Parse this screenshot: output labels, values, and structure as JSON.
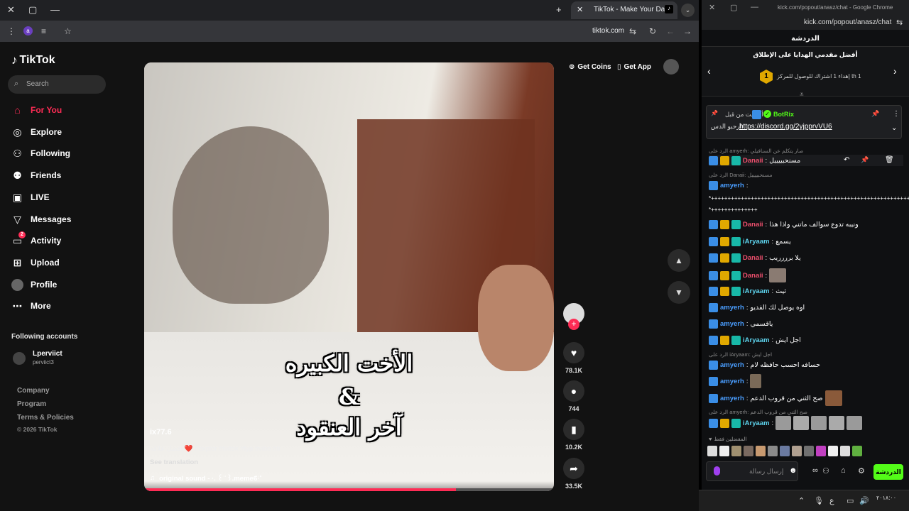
{
  "left_window": {
    "tab_title": "TikTok - Make Your Day",
    "url": "tiktok.com",
    "profile_badge": "a"
  },
  "tiktok": {
    "logo": "TikTok",
    "search_placeholder": "Search",
    "nav": [
      {
        "label": "For You",
        "icon": "home-icon"
      },
      {
        "label": "Explore",
        "icon": "compass-icon"
      },
      {
        "label": "Following",
        "icon": "user-follow-icon"
      },
      {
        "label": "Friends",
        "icon": "friends-icon"
      },
      {
        "label": "LIVE",
        "icon": "live-icon"
      },
      {
        "label": "Messages",
        "icon": "message-icon"
      },
      {
        "label": "Activity",
        "icon": "activity-icon",
        "badge": "2"
      },
      {
        "label": "Upload",
        "icon": "upload-icon"
      },
      {
        "label": "Profile",
        "icon": "profile-icon"
      },
      {
        "label": "More",
        "icon": "more-icon"
      }
    ],
    "following_heading": "Following accounts",
    "following_account": {
      "name": "Lperviict",
      "handle": "perviict3"
    },
    "footer_links": [
      "Company",
      "Program",
      "Terms & Policies"
    ],
    "copyright": "© 2026 TikTok",
    "top_actions": {
      "coins": "Get Coins",
      "app": "Get App"
    },
    "video": {
      "caption_line1": "الأخت الكبيره",
      "caption_line2": "&",
      "caption_line3": "آخر العنقود",
      "author": "ix77.6",
      "description": "افضل علاقه ❤️ #explor #tiktok #fyp #vibe #ti",
      "see_translation": "See translation",
      "sound": "original sound - ·. ꒰ ̈ ꒱.memeϐ̈·˚",
      "progress": 0.76
    },
    "rail": {
      "likes": "78.1K",
      "comments": "744",
      "saves": "10.2K",
      "shares": "33.5K"
    }
  },
  "right_window": {
    "title": "kick.com/popout/anasz/chat - Google Chrome",
    "url": "kick.com/popout/anasz/chat",
    "header": "الدردشة",
    "top_gifters_title": "أفضل مقدمي الهدايا على الإطلاق",
    "top_gifter_rank": "1",
    "top_gifter_text": "إهداء 1 اشتراك للوصول للمركز th 1",
    "pinned": {
      "pinned_by": "أرسلت من قبل",
      "bot": "BotRix",
      "message_prefix": "ارحبو الدس",
      "link": "https://discord.gg/2yjpprvVU6"
    },
    "messages": [
      {
        "reply": "الرد على amyerh: صار يتكلم عن السنافيلي",
        "user": "Danaii",
        "text": "مسنحبييييل",
        "color": "#f0506e"
      },
      {
        "reply": "الرد على Danaii: مسنحبييييل",
        "user": "amyerh",
        "text": "",
        "color": "#4a9eff"
      },
      {
        "user": "",
        "text": "*++++++++++++++++++++++++++++++++++++++++++++++++++++++++++++",
        "color": "#fff"
      },
      {
        "user": "",
        "text": "*++++++++++++++",
        "color": "#fff"
      },
      {
        "user": "Danaii",
        "text": "ونيبه تدوع سوالف ماتني واذا هذا",
        "color": "#f0506e"
      },
      {
        "user": "iAryaam",
        "text": "يسمع",
        "color": "#5fd6f0"
      },
      {
        "user": "Danaii",
        "text": "يلا برررريب",
        "color": "#f0506e"
      },
      {
        "user": "Danaii",
        "text": "",
        "color": "#f0506e"
      },
      {
        "user": "iAryaam",
        "text": "ثيث",
        "color": "#5fd6f0"
      },
      {
        "user": "amyerh",
        "text": "اوه يوصل لك الفديو",
        "color": "#4a9eff"
      },
      {
        "user": "amyerh",
        "text": "ياقسمي",
        "color": "#4a9eff"
      },
      {
        "user": "iAryaam",
        "text": "اجل ايش",
        "color": "#5fd6f0"
      },
      {
        "reply": "الرد على iAryaam: اجل ايش",
        "user": "amyerh",
        "text": "حسافه احسب حافظه لام",
        "color": "#4a9eff"
      },
      {
        "user": "amyerh",
        "text": "",
        "color": "#4a9eff"
      },
      {
        "user": "amyerh",
        "text": "صح الثني من قروب الدعم",
        "color": "#4a9eff"
      },
      {
        "reply": "الرد على amyerh: صح الثني من قروب الدعم",
        "user": "iAryaam",
        "text": "",
        "color": "#5fd6f0"
      }
    ],
    "emote_picker_label": "المفضلين فقط",
    "input_placeholder": "إرسال رسالة",
    "send_label": "الدردشة",
    "clock": "٢٠١٨:٠٠"
  }
}
